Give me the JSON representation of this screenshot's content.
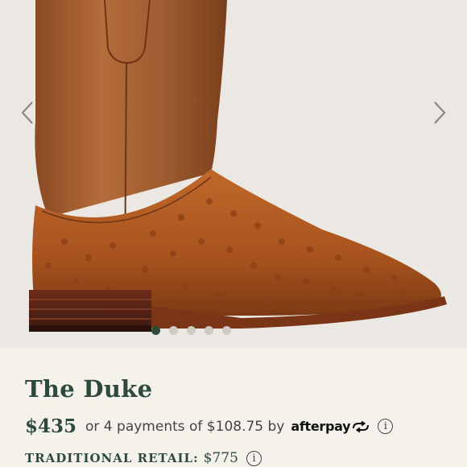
{
  "product": {
    "title": "The Duke",
    "price": "$435",
    "installment_text": "or 4 payments of $108.75 by",
    "payment_provider": "afterpay",
    "retail_label": "TRADITIONAL RETAIL:",
    "retail_price": "$775"
  },
  "gallery": {
    "slide_count": 5,
    "active_slide": 1,
    "image_description_icon": "ostrich-cowboy-boot"
  },
  "icons": {
    "prev": "chevron-left-icon",
    "next": "chevron-right-icon",
    "info": "info-icon",
    "afterpay_logo": "afterpay-arrows-icon"
  },
  "colors": {
    "brand_green": "#2d4a3b",
    "background": "#f5f2ec",
    "gallery_bg": "#ebe8e3"
  }
}
